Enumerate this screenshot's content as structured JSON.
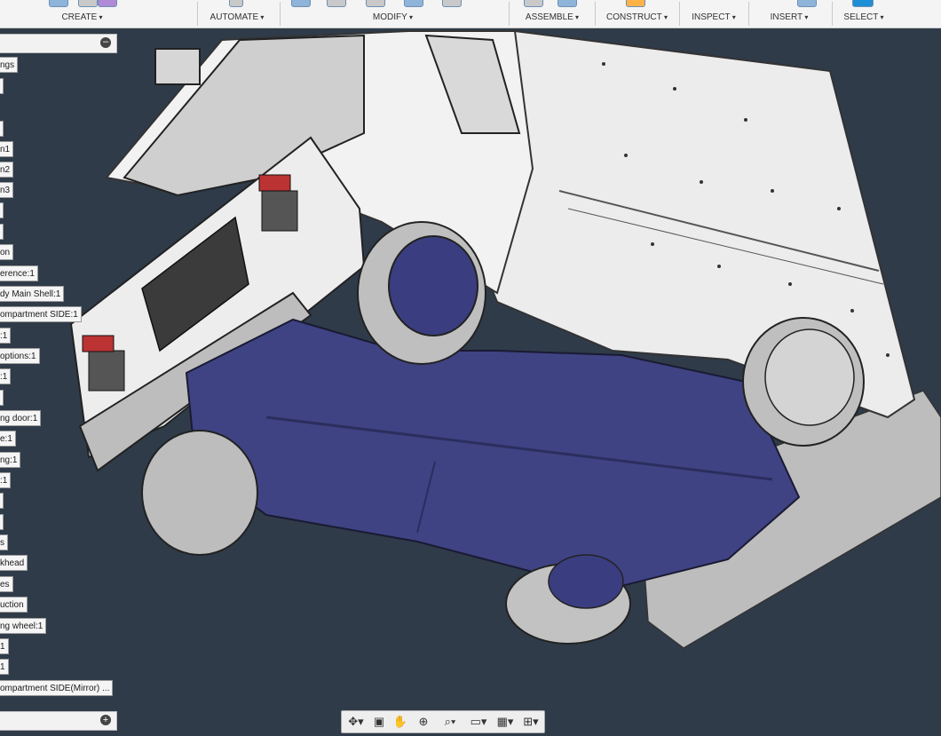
{
  "toolbar": {
    "groups": [
      {
        "label": "CREATE"
      },
      {
        "label": "AUTOMATE"
      },
      {
        "label": "MODIFY"
      },
      {
        "label": "ASSEMBLE"
      },
      {
        "label": "CONSTRUCT"
      },
      {
        "label": "INSPECT"
      },
      {
        "label": "INSERT"
      },
      {
        "label": "SELECT"
      }
    ]
  },
  "browser": {
    "items": [
      {
        "label": "ngs"
      },
      {
        "label": ""
      },
      {
        "label": ""
      },
      {
        "label": "n1"
      },
      {
        "label": "n2"
      },
      {
        "label": "n3"
      },
      {
        "label": ""
      },
      {
        "label": ""
      },
      {
        "label": "on"
      },
      {
        "label": "erence:1"
      },
      {
        "label": "dy Main Shell:1"
      },
      {
        "label": "ompartment SIDE:1"
      },
      {
        "label": ":1"
      },
      {
        "label": "options:1"
      },
      {
        "label": ":1"
      },
      {
        "label": ""
      },
      {
        "label": "ng door:1"
      },
      {
        "label": "e:1"
      },
      {
        "label": "ng:1"
      },
      {
        "label": ":1"
      },
      {
        "label": ""
      },
      {
        "label": ""
      },
      {
        "label": "s"
      },
      {
        "label": "khead"
      },
      {
        "label": "es"
      },
      {
        "label": "uction"
      },
      {
        "label": "ng wheel:1"
      },
      {
        "label": "1"
      },
      {
        "label": "1"
      },
      {
        "label": "ompartment SIDE(Mirror) ..."
      }
    ]
  },
  "nav": {
    "icons": [
      "orbit-icon",
      "look-at-icon",
      "pan-icon",
      "zoom-icon",
      "fit-icon",
      "display-settings-icon",
      "grid-icon",
      "viewports-icon"
    ]
  },
  "colors": {
    "viewport": "#2f3b49",
    "truck_body": "#e6e6e6",
    "chassis": "#3f4383",
    "toolbar": "#f4f4f4"
  }
}
